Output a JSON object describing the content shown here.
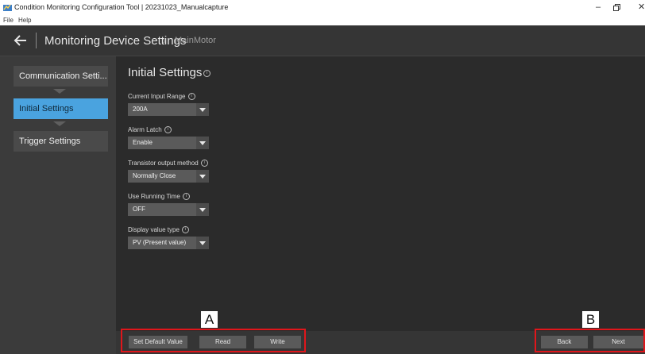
{
  "window": {
    "title": "Condition Monitoring Configuration Tool  |  20231023_Manualcapture",
    "controls": [
      "–",
      "▫",
      "✕"
    ]
  },
  "menu": [
    "File",
    "Help"
  ],
  "header": {
    "title": "Monitoring Device Settings",
    "breadcrumb_separator": "›",
    "breadcrumb": "MainMotor"
  },
  "sidebar": {
    "steps": [
      {
        "label": "Communication Setti...",
        "active": false
      },
      {
        "label": "Initial Settings",
        "active": true
      },
      {
        "label": "Trigger Settings",
        "active": false
      }
    ]
  },
  "main": {
    "title": "Initial Settings",
    "info_glyph": "i",
    "fields": [
      {
        "label": "Current Input Range",
        "value": "200A"
      },
      {
        "label": "Alarm Latch",
        "value": "Enable"
      },
      {
        "label": "Transistor output method",
        "value": "Normally Close"
      },
      {
        "label": "Use Running Time",
        "value": "OFF"
      },
      {
        "label": "Display value type",
        "value": "PV (Present value)"
      }
    ]
  },
  "footer": {
    "set_default": "Set Default Value",
    "read": "Read",
    "write": "Write",
    "back": "Back",
    "next": "Next"
  },
  "annotations": {
    "a": "A",
    "b": "B"
  },
  "colors": {
    "accent": "#4aa3df",
    "highlight": "#e0161b"
  }
}
